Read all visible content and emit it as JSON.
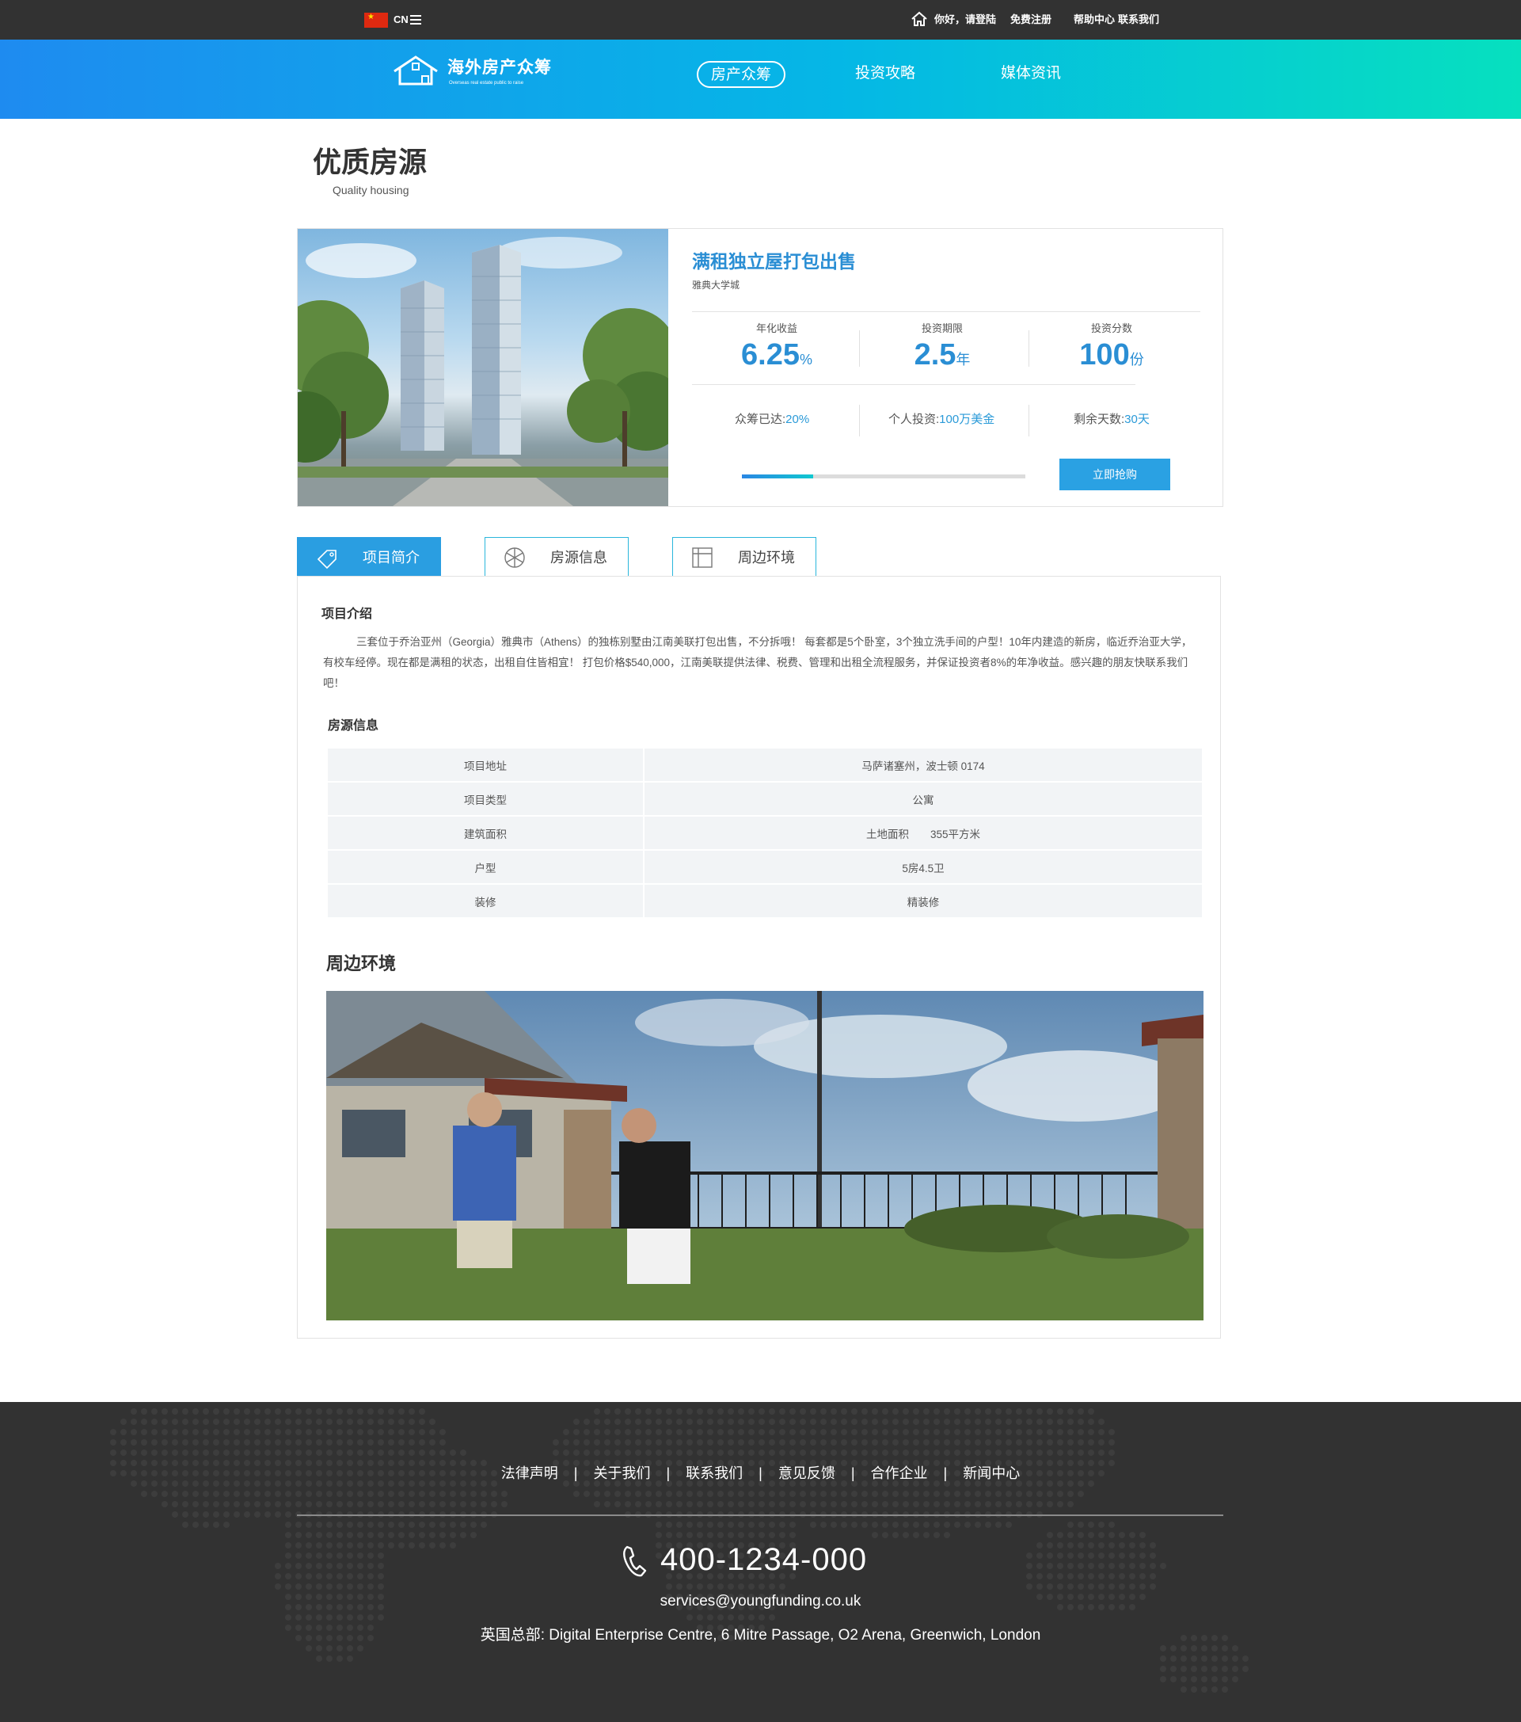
{
  "topbar": {
    "lang": "CN",
    "greeting": "你好，请登陆",
    "register": "免费注册",
    "help": "帮助中心",
    "contact": "联系我们"
  },
  "nav": {
    "logo_text": "海外房产众筹",
    "logo_sub": "Overseas real estate public to raise",
    "items": [
      {
        "label": "房产众筹",
        "active": true
      },
      {
        "label": "投资攻略",
        "active": false
      },
      {
        "label": "媒体资讯",
        "active": false
      }
    ]
  },
  "section": {
    "title": "优质房源",
    "subtitle": "Quality housing"
  },
  "product": {
    "title": "满租独立屋打包出售",
    "location": "雅典大学城",
    "stats": [
      {
        "label": "年化收益",
        "value": "6.25",
        "unit": "%"
      },
      {
        "label": "投资期限",
        "value": "2.5",
        "unit": "年"
      },
      {
        "label": "投资分数",
        "value": "100",
        "unit": "份"
      }
    ],
    "raised_label": "众筹已达:",
    "raised_value": "20%",
    "personal_label": "个人投资:",
    "personal_value": "100万美金",
    "days_label": "剩余天数:",
    "days_value": "30天",
    "progress": 0.25,
    "buy_label": "立即抢购"
  },
  "tabs": [
    {
      "label": "项目简介",
      "icon": "tag-icon",
      "active": true
    },
    {
      "label": "房源信息",
      "icon": "snowflake-icon",
      "active": false
    },
    {
      "label": "周边环境",
      "icon": "layout-icon",
      "active": false
    }
  ],
  "content": {
    "intro_title": "项目介绍",
    "intro_text": "三套位于乔治亚州（Georgia）雅典市（Athens）的独栋别墅由江南美联打包出售，不分拆哦！ 每套都是5个卧室，3个独立洗手间的户型！10年内建造的新房，临近乔治亚大学，有校车经停。现在都是满租的状态，出租自住皆相宜！   打包价格$540,000，江南美联提供法律、税费、管理和出租全流程服务，并保证投资者8%的年净收益。感兴趣的朋友快联系我们吧！",
    "info_title": "房源信息",
    "rows": [
      {
        "key": "项目地址",
        "value": "马萨诸塞州，波士顿 0174"
      },
      {
        "key": "项目类型",
        "value": "公寓"
      },
      {
        "key": "建筑面积",
        "value": "土地面积　　355平方米"
      },
      {
        "key": "户型",
        "value": "5房4.5卫"
      },
      {
        "key": "装修",
        "value": "精装修"
      }
    ],
    "env_title": "周边环境"
  },
  "footer": {
    "links": [
      "法律声明",
      "关于我们",
      "联系我们",
      "意见反馈",
      "合作企业",
      "新闻中心"
    ],
    "separator": "|",
    "phone": "400-1234-000",
    "email": "services@youngfunding.co.uk",
    "address": "英国总部: Digital Enterprise Centre, 6 Mitre Passage, O2 Arena, Greenwich, London"
  },
  "colors": {
    "accent": "#2a9ee1",
    "title_blue": "#2a8ed4",
    "topbar": "#323232",
    "nav_gradient_start": "#1e8bf0",
    "nav_gradient_end": "#06e0bf"
  }
}
